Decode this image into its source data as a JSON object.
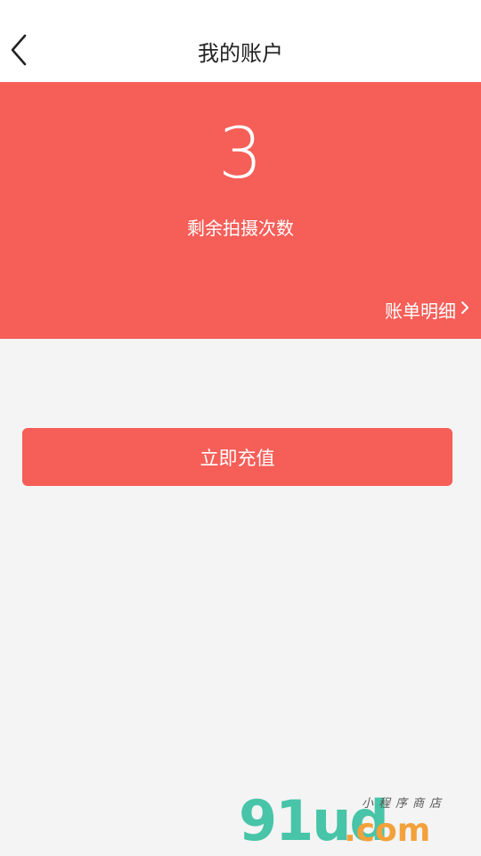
{
  "header": {
    "title": "我的账户",
    "back_icon": "chevron-left-icon"
  },
  "account": {
    "remaining_count": "3",
    "remaining_label": "剩余拍摄次数",
    "bill_detail_label": "账单明细",
    "bill_detail_icon": "chevron-right-icon"
  },
  "actions": {
    "recharge_label": "立即充值"
  },
  "watermark": {
    "logo": "91ud",
    "domain": ".com",
    "tagline": "小程序商店"
  },
  "colors": {
    "accent": "#f65e58",
    "background": "#f4f4f4",
    "navbar": "#ffffff"
  }
}
